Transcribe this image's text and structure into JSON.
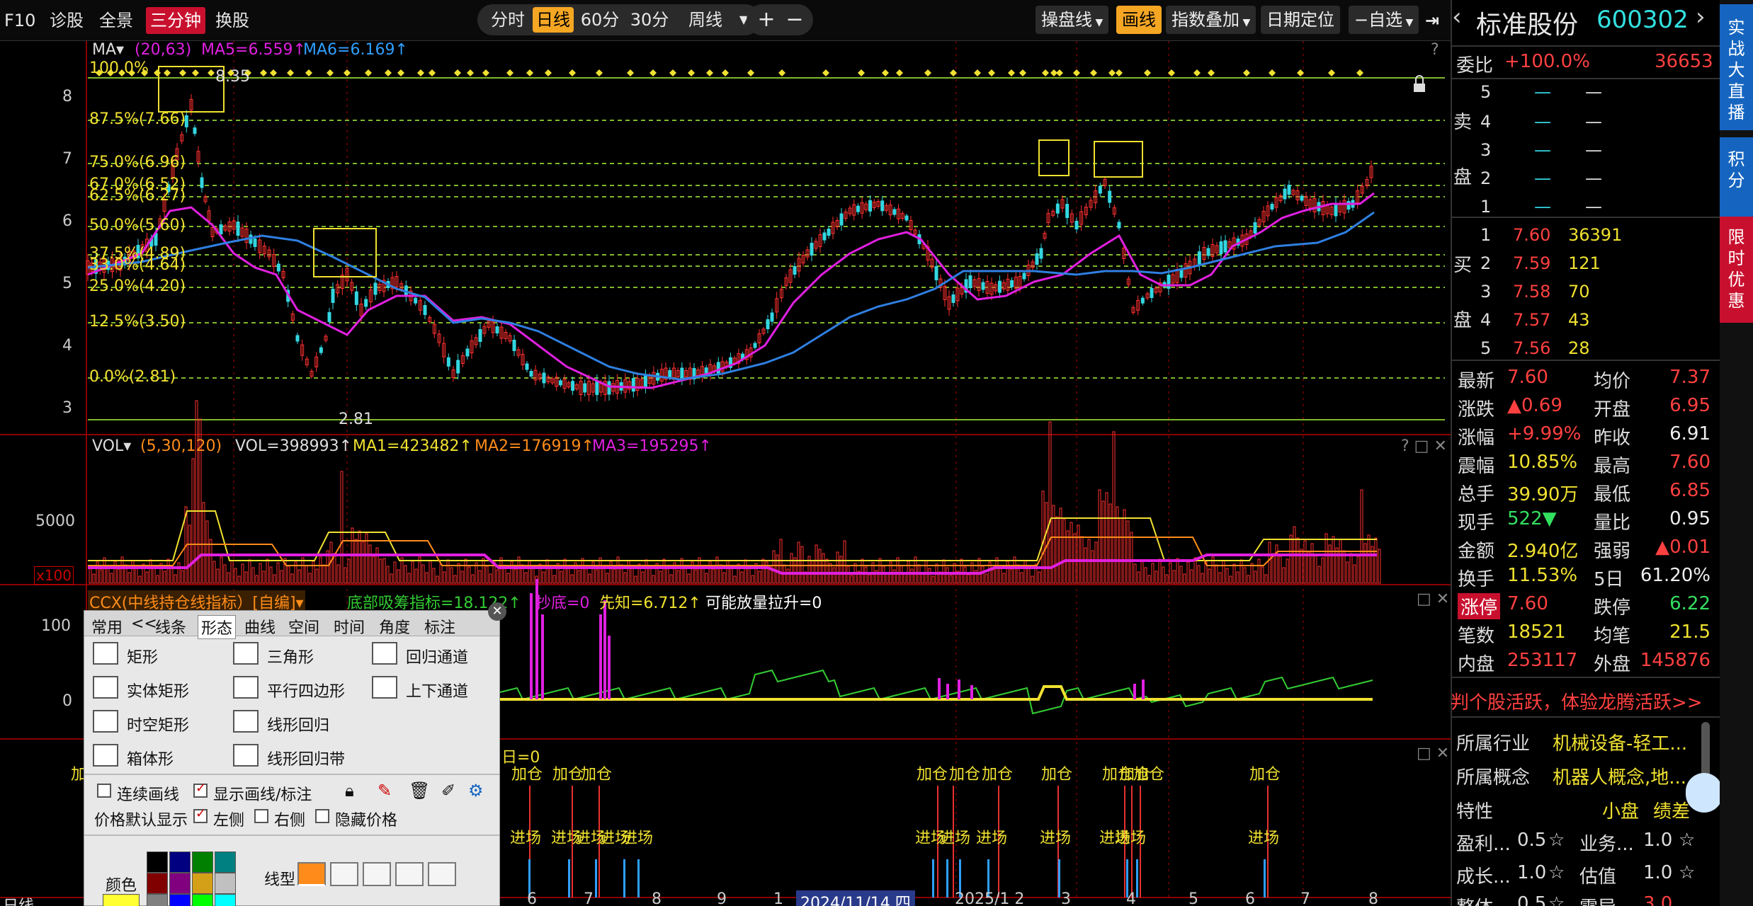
{
  "toolbar": {
    "f10": "F10",
    "diagnose": "诊股",
    "fullscreen": "全景",
    "mode": "三分钟",
    "switch_stock": "换股",
    "periods": [
      "分时",
      "日线",
      "60分",
      "30分",
      "周线"
    ],
    "active_period": "日线",
    "plus": "+",
    "minus": "−",
    "operate_line": "操盘线",
    "draw_line": "画线",
    "index_overlay": "指数叠加",
    "date_locate": "日期定位",
    "watchlist": "自选"
  },
  "main_chart": {
    "ma_label": "MA▾",
    "ma_params": "(20,63)",
    "ma5": "MA5=6.559↑",
    "ma6": "MA6=6.169↑",
    "help": "?",
    "y_ticks": [
      "8",
      "7",
      "6",
      "5",
      "4",
      "3"
    ],
    "fib_levels": [
      "87.5%(7.66)",
      "75.0%(6.96)",
      "67.0%(6.52)",
      "62.5%(6.27)",
      "50.0%(5.60)",
      "37.5%(4.89)",
      "33.0%(4.64)",
      "25.0%(4.20)",
      "12.5%(3.50)",
      "0.0%(2.81)"
    ],
    "fib_top": "100.0%",
    "high_label": "8.35",
    "low_label": "2.81"
  },
  "vol_chart": {
    "label": "VOL▾",
    "params": "(5,30,120)",
    "vol": "VOL=398993↑",
    "ma1": "MA1=423482↑",
    "ma2": "MA2=176919↑",
    "ma3": "MA3=195295↑",
    "y_tick": "5000",
    "unit": "x100"
  },
  "ccx_chart": {
    "label": "CCX(中线持仓线指标）[自编]▾",
    "bottom_absorb": "底部吸筹指标=18.122↑",
    "chaodi": "抄底=0",
    "xianzhi": "先知=6.712↑",
    "surge": "可能放量拉升=0",
    "y_ticks": [
      "100",
      "0"
    ]
  },
  "signal_chart": {
    "label": "日=0",
    "add": "加仓",
    "enter": "进场",
    "left_add": "加"
  },
  "x_axis": {
    "labels": [
      "6",
      "7",
      "8",
      "9",
      "1",
      "2024/11/14 四",
      "2025/1 2",
      "3",
      "4",
      "5",
      "6",
      "7",
      "8"
    ]
  },
  "quote": {
    "name": "标准股份",
    "code": "600302",
    "weibi_label": "委比",
    "weibi": "+100.0%",
    "weicha": "36653",
    "sell_label": [
      "卖",
      "盘"
    ],
    "buy_label": [
      "买",
      "盘"
    ],
    "sell": [
      {
        "lvl": "5",
        "p": "—",
        "v": "—"
      },
      {
        "lvl": "4",
        "p": "—",
        "v": "—"
      },
      {
        "lvl": "3",
        "p": "—",
        "v": "—"
      },
      {
        "lvl": "2",
        "p": "—",
        "v": "—"
      },
      {
        "lvl": "1",
        "p": "—",
        "v": "—"
      }
    ],
    "buy": [
      {
        "lvl": "1",
        "p": "7.60",
        "v": "36391"
      },
      {
        "lvl": "2",
        "p": "7.59",
        "v": "121"
      },
      {
        "lvl": "3",
        "p": "7.58",
        "v": "70"
      },
      {
        "lvl": "4",
        "p": "7.57",
        "v": "43"
      },
      {
        "lvl": "5",
        "p": "7.56",
        "v": "28"
      }
    ],
    "stats": [
      {
        "k1": "最新",
        "v1": "7.60",
        "k2": "均价",
        "v2": "7.37"
      },
      {
        "k1": "涨跌",
        "v1": "▲0.69",
        "k2": "开盘",
        "v2": "6.95"
      },
      {
        "k1": "涨幅",
        "v1": "+9.99%",
        "k2": "昨收",
        "v2": "6.91"
      },
      {
        "k1": "震幅",
        "v1": "10.85%",
        "k2": "最高",
        "v2": "7.60"
      },
      {
        "k1": "总手",
        "v1": "39.90万",
        "k2": "最低",
        "v2": "6.85"
      },
      {
        "k1": "现手",
        "v1": "522▼",
        "k2": "量比",
        "v2": "0.95"
      },
      {
        "k1": "金额",
        "v1": "2.940亿",
        "k2": "强弱",
        "v2": "▲0.01"
      },
      {
        "k1": "换手",
        "v1": "11.53%",
        "k2": "5日",
        "v2": "61.20%"
      },
      {
        "k1": "涨停",
        "v1": "7.60",
        "k2": "跌停",
        "v2": "6.22"
      },
      {
        "k1": "笔数",
        "v1": "18521",
        "k2": "均笔",
        "v2": "21.5"
      },
      {
        "k1": "内盘",
        "v1": "253117",
        "k2": "外盘",
        "v2": "145876"
      }
    ],
    "promo": "判个股活跃，体验龙腾活跃>>",
    "industry_label": "所属行业",
    "industry": "机械设备-轻工...",
    "concept_label": "所属概念",
    "concept": "机器人概念,地...",
    "trait_label": "特性",
    "trait1": "小盘",
    "trait2": "绩差",
    "row_a1": "盈利...",
    "row_a1v": "0.5",
    "row_a2": "业务...",
    "row_a2v": "1.0",
    "row_b1": "成长...",
    "row_b1v": "1.0",
    "row_b2": "估值",
    "row_b2v": "1.0",
    "row_c1": "整体",
    "row_c1v": "0.5",
    "row_c2": "需导",
    "row_c2v": "3.0"
  },
  "side": {
    "live": "实战大直播",
    "points": "积分",
    "promo": "限时优惠"
  },
  "draw_panel": {
    "tabs": [
      "常用",
      "<<",
      "线条",
      "形态",
      "曲线",
      "空间",
      "时间",
      "角度",
      "标注"
    ],
    "active_tab": "形态",
    "shapes": [
      "矩形",
      "三角形",
      "回归通道",
      "实体矩形",
      "平行四边形",
      "上下通道",
      "时空矩形",
      "线形回归",
      "箱体形",
      "线形回归带"
    ],
    "opt_continuous": "连续画线",
    "opt_show": "显示画线/标注",
    "price_default": "价格默认显示",
    "opt_left": "左侧",
    "opt_right": "右侧",
    "opt_hide": "隐藏价格",
    "color_label": "颜色",
    "line_type_label": "线型"
  },
  "status": {
    "mode": "日线"
  }
}
